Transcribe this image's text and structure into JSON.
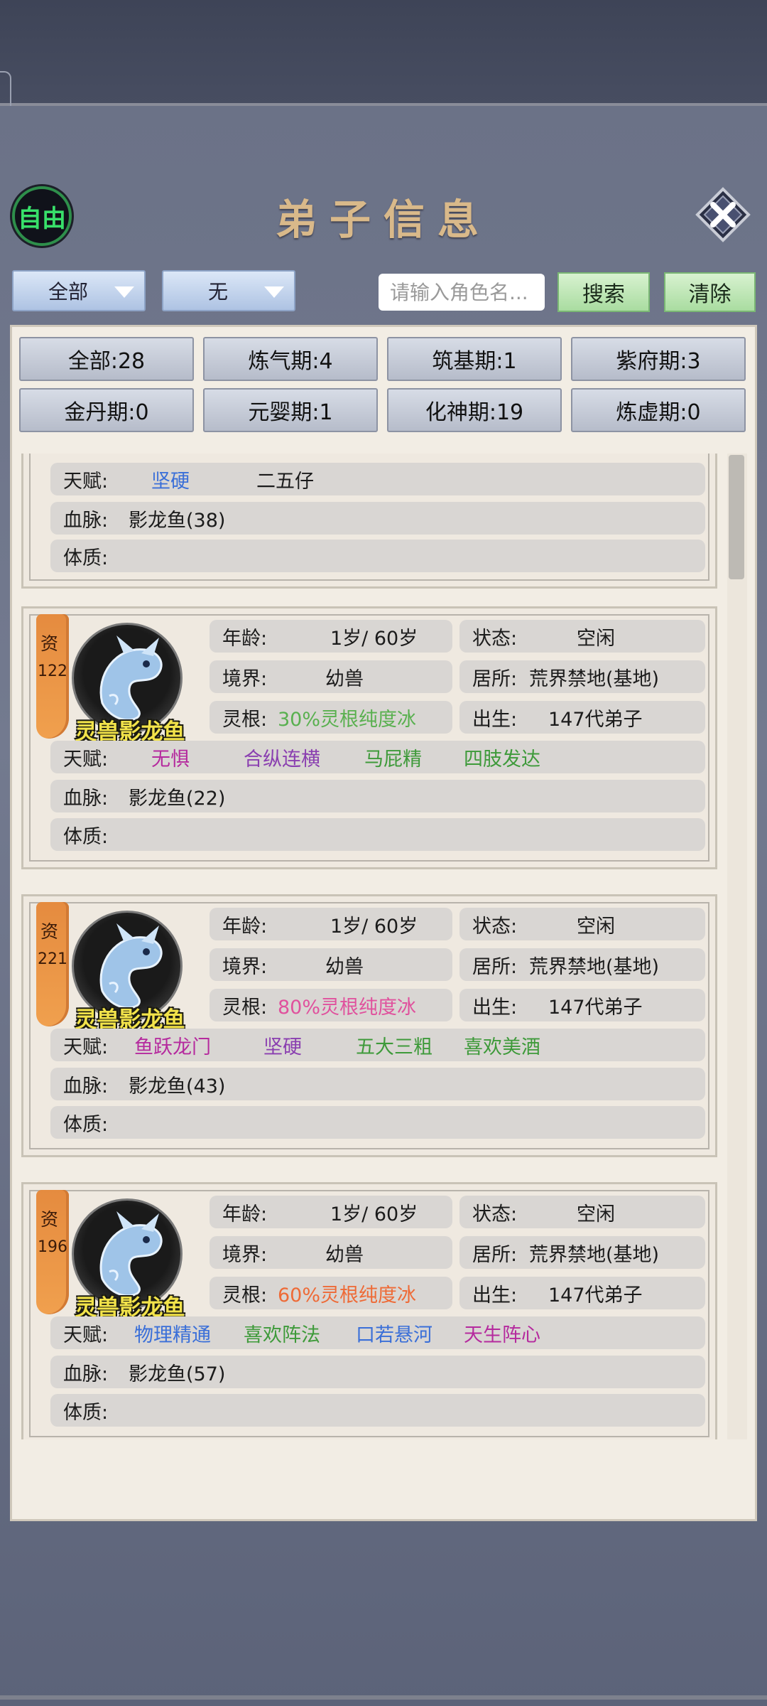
{
  "header": {
    "free_badge": "自由",
    "title": "弟子信息",
    "close_icon": "close-x-icon"
  },
  "filters": {
    "dropdown1": "全部",
    "dropdown2": "无",
    "search_placeholder": "请输入角色名...",
    "search_button": "搜索",
    "clear_button": "清除"
  },
  "stats": [
    {
      "label": "全部:28"
    },
    {
      "label": "炼气期:4"
    },
    {
      "label": "筑基期:1"
    },
    {
      "label": "紫府期:3"
    },
    {
      "label": "金丹期:0"
    },
    {
      "label": "元婴期:1"
    },
    {
      "label": "化神期:19"
    },
    {
      "label": "炼虚期:0"
    }
  ],
  "partial_card": {
    "talent_key": "天赋:",
    "talents": [
      "坚硬",
      "二五仔"
    ],
    "bloodline_key": "血脉:",
    "bloodline": "影龙鱼(38)",
    "constitution_key": "体质:"
  },
  "labels": {
    "age": "年龄:",
    "status": "状态:",
    "realm": "境界:",
    "residence": "居所:",
    "root": "灵根:",
    "birth": "出生:",
    "talent": "天赋:",
    "bloodline": "血脉:",
    "constitution": "体质:",
    "zi": "资"
  },
  "cards": [
    {
      "aptitude": "122",
      "name": "灵兽影龙鱼",
      "age": "1岁/ 60岁",
      "status": "空闲",
      "realm": "幼兽",
      "residence": "荒界禁地(基地)",
      "root": "30%灵根纯度冰",
      "root_color": "#59b04f",
      "birth": "147代弟子",
      "talents": [
        {
          "text": "无惧",
          "color": "#b52a9e"
        },
        {
          "text": "合纵连横",
          "color": "#8a3fb0"
        },
        {
          "text": "马屁精",
          "color": "#3e9a3a"
        },
        {
          "text": "四肢发达",
          "color": "#3e9a3a"
        }
      ],
      "bloodline": "影龙鱼(22)"
    },
    {
      "aptitude": "221",
      "name": "灵兽影龙鱼",
      "age": "1岁/ 60岁",
      "status": "空闲",
      "realm": "幼兽",
      "residence": "荒界禁地(基地)",
      "root": "80%灵根纯度冰",
      "root_color": "#e0519d",
      "birth": "147代弟子",
      "talents": [
        {
          "text": "鱼跃龙门",
          "color": "#b52a9e"
        },
        {
          "text": "坚硬",
          "color": "#8a3fb0"
        },
        {
          "text": "五大三粗",
          "color": "#3e9a3a"
        },
        {
          "text": "喜欢美酒",
          "color": "#3e9a3a"
        }
      ],
      "bloodline": "影龙鱼(43)"
    },
    {
      "aptitude": "196",
      "name": "灵兽影龙鱼",
      "age": "1岁/ 60岁",
      "status": "空闲",
      "realm": "幼兽",
      "residence": "荒界禁地(基地)",
      "root": "60%灵根纯度冰",
      "root_color": "#ee6a36",
      "birth": "147代弟子",
      "talents": [
        {
          "text": "物理精通",
          "color": "#3a6fd8"
        },
        {
          "text": "喜欢阵法",
          "color": "#3e9a3a"
        },
        {
          "text": "口若悬河",
          "color": "#3a6fd8"
        },
        {
          "text": "天生阵心",
          "color": "#b52a9e"
        }
      ],
      "bloodline": "影龙鱼(57)"
    }
  ]
}
